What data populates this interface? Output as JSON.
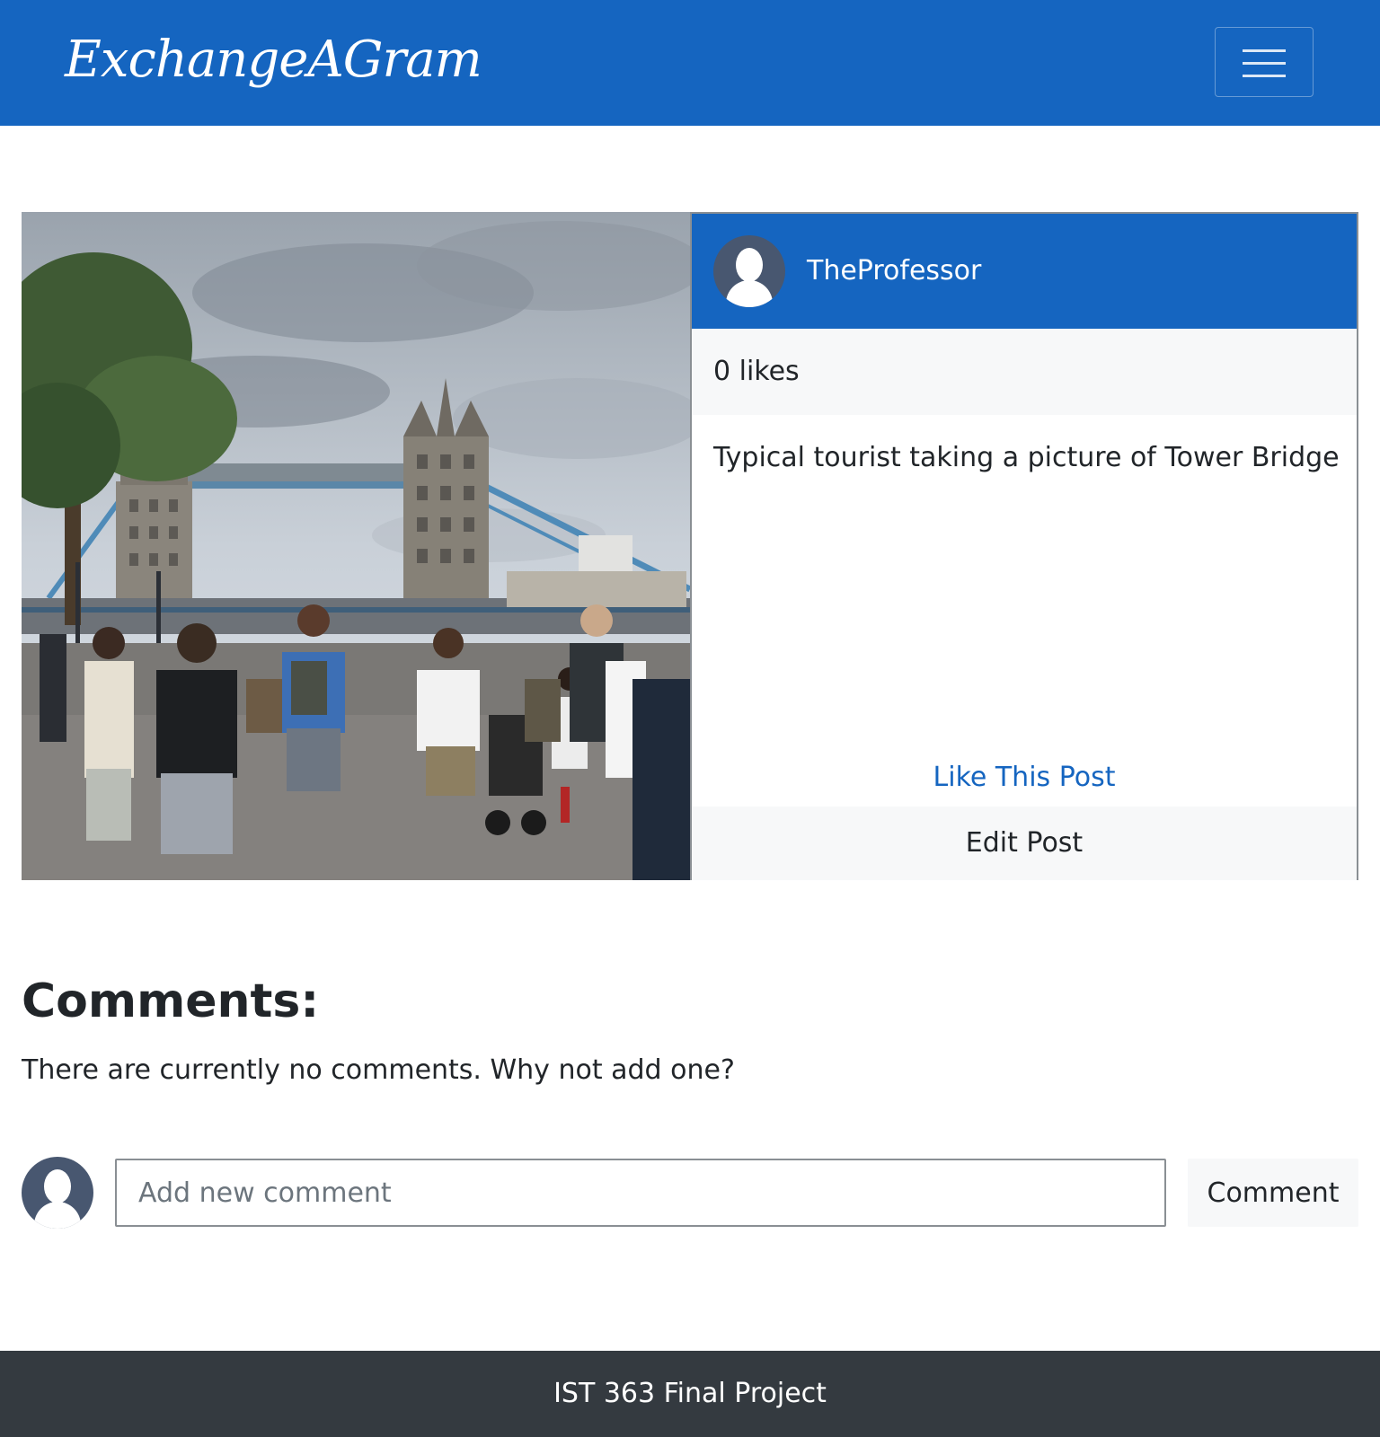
{
  "navbar": {
    "brand": "ExchangeAGram",
    "menu_icon": "hamburger-menu-icon",
    "color": "#1565c0"
  },
  "post": {
    "photo_alt": "Tower Bridge",
    "username": "TheProfessor",
    "avatar_icon": "user-avatar-icon",
    "likes": "0 likes",
    "caption": "Typical tourist taking a picture of Tower Bridge",
    "like_label": "Like This Post",
    "edit_label": "Edit Post"
  },
  "comments": {
    "title": "Comments:",
    "empty_message": "There are currently no comments. Why not add one?",
    "input_placeholder": "Add new comment",
    "input_value": "",
    "submit_label": "Comment"
  },
  "footer": {
    "text": "IST 363 Final Project",
    "color": "#343a40"
  }
}
